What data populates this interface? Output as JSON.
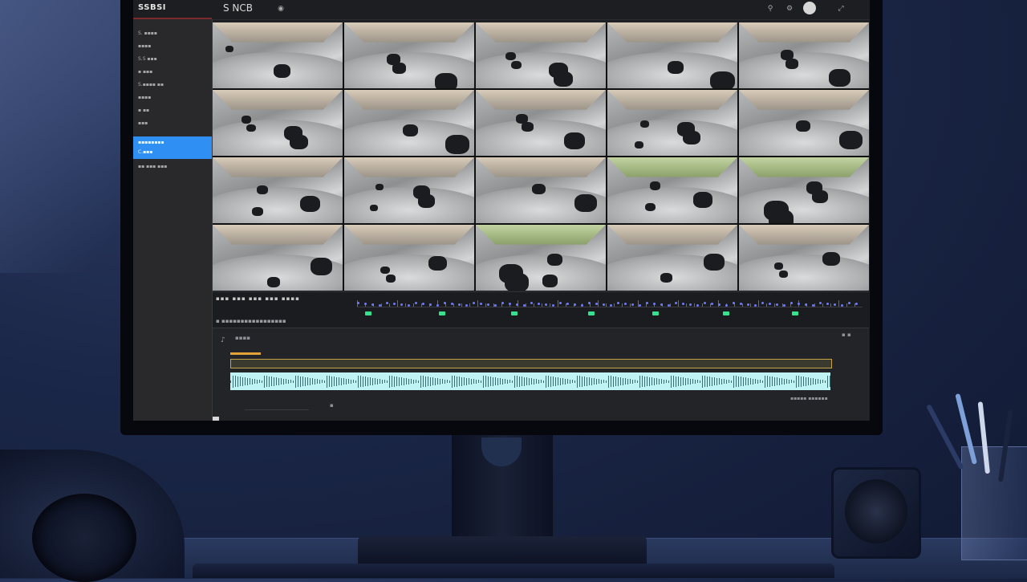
{
  "app": {
    "brand": "SSBSI",
    "title": "S NCB",
    "accent_color": "#2f8ff2"
  },
  "sidebar": {
    "items": [
      {
        "label": "S. ▪▪▪▪"
      },
      {
        "label": "▪▪▪▪"
      },
      {
        "label": "S.S ▪▪▪"
      },
      {
        "label": "▪ ▪▪▪"
      },
      {
        "label": "S.▪▪▪▪ ▪▪"
      },
      {
        "label": "▪▪▪▪"
      },
      {
        "label": "▪ ▪▪"
      },
      {
        "label": "▪▪▪"
      }
    ],
    "active": {
      "line1": "▪▪▪▪▪▪▪▪",
      "line2": "C.▪▪▪"
    },
    "after": {
      "label": "▪▪ ▪▪▪ ▪▪▪"
    }
  },
  "header_icons": [
    "link-icon",
    "gear-icon",
    "user-avatar",
    "expand-icon"
  ],
  "timeline": {
    "toolbar_text": "▪▪▪ ▪▪▪ ▪▪▪ ▪▪▪ ▪▪▪▪",
    "track_label": "▪ ▪▪▪▪▪▪▪▪▪▪▪▪▪▪▪▪▪",
    "marker_color": "#35e38f"
  },
  "waveform": {
    "title": "▪▪▪▪",
    "time": "▪▪▪▪▪ ▪▪▪▪▪▪",
    "controls": "▪ ▪",
    "play_symbol": "▪",
    "wave_color": "#bff3f4"
  }
}
